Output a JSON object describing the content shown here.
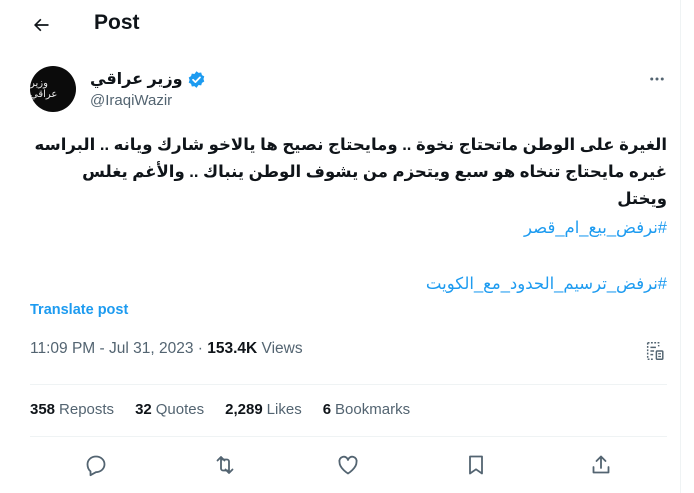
{
  "header": {
    "title": "Post"
  },
  "author": {
    "name": "وزير عراقي",
    "handle": "@IraqiWazir",
    "avatar_text": "وزير عراقي",
    "verified": true
  },
  "post": {
    "line1": "الغيرة على الوطن ماتحتاج نخوة .. ومايحتاج نصيح ها يالاخو شارك ويانه .. البراسه",
    "line2": "غيره مايحتاج تنخاه هو سبع ويتحزم من يشوف الوطن ينباك .. والأغم يغلس ويختل",
    "hashtags": [
      "#نرفض_بيع_ام_قصر",
      "#نرفض_ترسيم_الحدود_مع_الكويت"
    ],
    "translate": "Translate post",
    "time": "11:09 PM",
    "date": "Jul 31, 2023",
    "sep": "·",
    "views_count": "153.4K",
    "views_label": "Views"
  },
  "stats": {
    "reposts_count": "358",
    "reposts_label": "Reposts",
    "quotes_count": "32",
    "quotes_label": "Quotes",
    "likes_count": "2,289",
    "likes_label": "Likes",
    "bookmarks_count": "6",
    "bookmarks_label": "Bookmarks"
  },
  "colors": {
    "accent": "#1d9bf0",
    "text": "#0f1419",
    "secondary": "#536471",
    "border": "#eff3f4"
  },
  "icons": [
    "back-arrow-icon",
    "verified-badge-icon",
    "more-icon",
    "analytics-icon",
    "reply-icon",
    "repost-icon",
    "like-icon",
    "bookmark-icon",
    "share-icon"
  ]
}
